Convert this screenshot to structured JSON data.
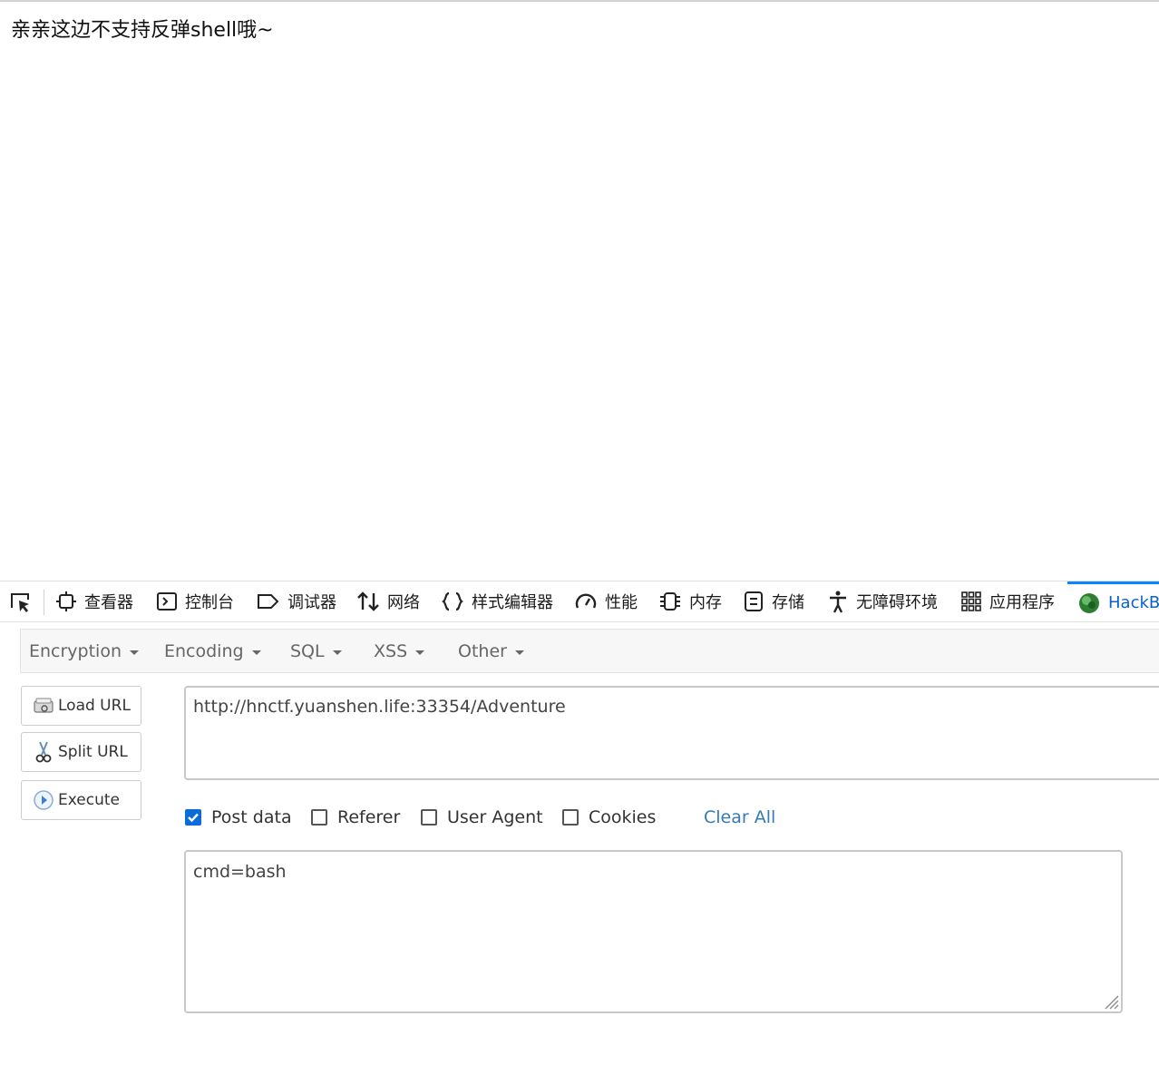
{
  "page": {
    "message": "亲亲这边不支持反弹shell哦~"
  },
  "devtools": {
    "tabs": [
      {
        "label": "查看器",
        "icon": "inspector-icon"
      },
      {
        "label": "控制台",
        "icon": "console-icon"
      },
      {
        "label": "调试器",
        "icon": "debugger-icon"
      },
      {
        "label": "网络",
        "icon": "network-icon"
      },
      {
        "label": "样式编辑器",
        "icon": "style-editor-icon"
      },
      {
        "label": "性能",
        "icon": "performance-icon"
      },
      {
        "label": "内存",
        "icon": "memory-icon"
      },
      {
        "label": "存储",
        "icon": "storage-icon"
      },
      {
        "label": "无障碍环境",
        "icon": "accessibility-icon"
      },
      {
        "label": "应用程序",
        "icon": "application-icon"
      },
      {
        "label": "HackBar",
        "icon": "hackbar-icon",
        "active": true
      }
    ],
    "accent_color": "#0a84ff"
  },
  "hackbar": {
    "menus": [
      "Encryption",
      "Encoding",
      "SQL",
      "XSS",
      "Other"
    ],
    "buttons": {
      "load_url": "Load URL",
      "split_url": "Split URL",
      "execute": "Execute"
    },
    "url_value": "http://hnctf.yuanshen.life:33354/Adventure",
    "options": {
      "post_data": {
        "label": "Post data",
        "checked": true
      },
      "referer": {
        "label": "Referer",
        "checked": false
      },
      "user_agent": {
        "label": "User Agent",
        "checked": false
      },
      "cookies": {
        "label": "Cookies",
        "checked": false
      }
    },
    "clear_all": "Clear All",
    "post_value": "cmd=bash",
    "link_color": "#337ab7",
    "checkbox_color": "#0a6cd6"
  }
}
